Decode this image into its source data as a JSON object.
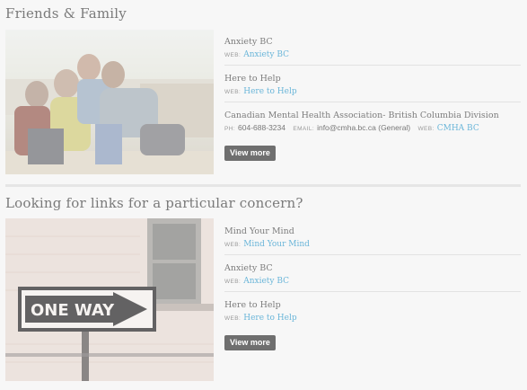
{
  "sections": [
    {
      "title": "Friends & Family",
      "image": "group-of-friends-photo",
      "items": [
        {
          "title": "Anxiety BC",
          "web_label": "WEB:",
          "web_link": "Anxiety BC"
        },
        {
          "title": "Here to Help",
          "web_label": "WEB:",
          "web_link": "Here to Help"
        },
        {
          "title": "Canadian Mental Health Association- British Columbia Division",
          "ph_label": "PH:",
          "phone": "604-688-3234",
          "email_label": "EMAIL:",
          "email": "info@cmha.bc.ca (General)",
          "web_label": "WEB:",
          "web_link": "CMHA BC"
        }
      ],
      "button": "View more"
    },
    {
      "title": "Looking for links for a particular concern?",
      "image": "one-way-sign-photo",
      "sign_text": "ONE WAY",
      "items": [
        {
          "title": "Mind Your Mind",
          "web_label": "WEB:",
          "web_link": "Mind Your Mind"
        },
        {
          "title": "Anxiety BC",
          "web_label": "WEB:",
          "web_link": "Anxiety BC"
        },
        {
          "title": "Here to Help",
          "web_label": "WEB:",
          "web_link": "Here to Help"
        }
      ],
      "button": "View more"
    }
  ],
  "colors": {
    "link": "#6bb6d9",
    "button": "#6f6f6f",
    "text": "#777777"
  }
}
